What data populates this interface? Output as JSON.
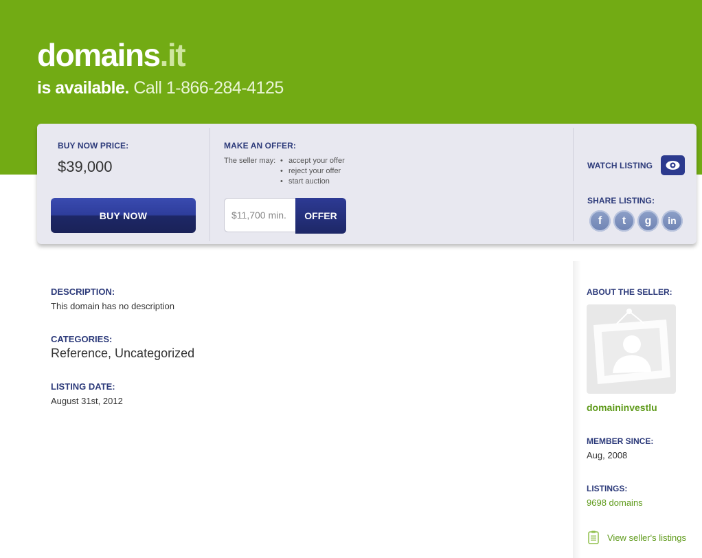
{
  "header": {
    "domain_name": "domains",
    "domain_tld": ".it",
    "available_text": "is available.",
    "call_text": "Call 1-866-284-4125"
  },
  "buy": {
    "label": "BUY NOW PRICE:",
    "price": "$39,000",
    "button": "BUY NOW"
  },
  "offer": {
    "label": "MAKE AN OFFER:",
    "seller_may": "The seller may:",
    "options": [
      "accept your offer",
      "reject your offer",
      "start auction"
    ],
    "placeholder": "$11,700 min.",
    "button": "OFFER"
  },
  "watch": {
    "label": "WATCH LISTING",
    "icon": "eye-icon"
  },
  "share": {
    "label": "SHARE LISTING:",
    "networks": [
      {
        "name": "facebook",
        "glyph": "f"
      },
      {
        "name": "twitter",
        "glyph": "t"
      },
      {
        "name": "google-plus",
        "glyph": "g"
      },
      {
        "name": "linkedin",
        "glyph": "in"
      }
    ]
  },
  "details": {
    "description_label": "DESCRIPTION:",
    "description": "This domain has no description",
    "categories_label": "CATEGORIES:",
    "categories": "Reference, Uncategorized",
    "listing_date_label": "LISTING DATE:",
    "listing_date": "August 31st, 2012"
  },
  "seller": {
    "about_label": "ABOUT THE SELLER:",
    "avatar_icon": "user-placeholder-icon",
    "username": "domaininvestlu",
    "member_since_label": "MEMBER SINCE:",
    "member_since": "Aug, 2008",
    "listings_label": "LISTINGS:",
    "listings_count": "9698 domains",
    "view_listings": "View seller's listings",
    "view_listings_icon": "clipboard-icon"
  },
  "colors": {
    "brand_green": "#72ab14",
    "navy": "#2c3a7a",
    "link_green": "#5e9a1a"
  }
}
